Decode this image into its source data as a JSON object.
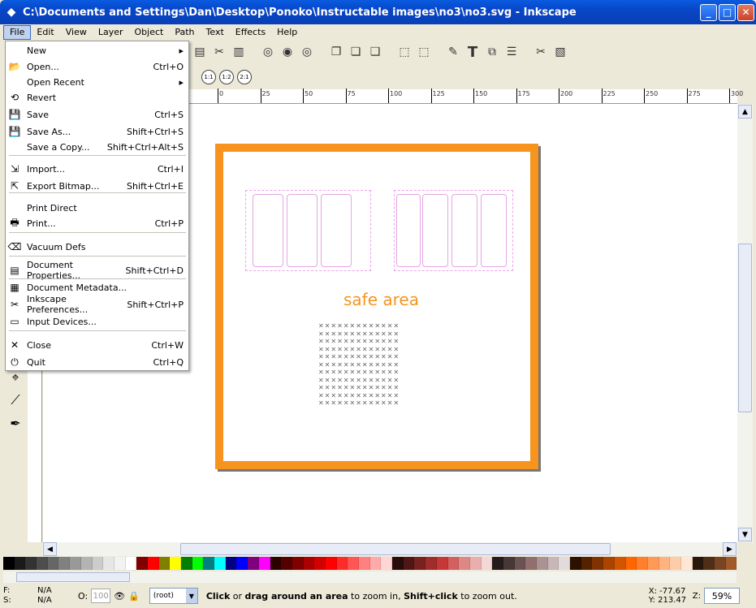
{
  "window": {
    "title": "C:\\Documents and Settings\\Dan\\Desktop\\Ponoko\\Instructable images\\no3\\no3.svg - Inkscape"
  },
  "menubar": [
    "File",
    "Edit",
    "View",
    "Layer",
    "Object",
    "Path",
    "Text",
    "Effects",
    "Help"
  ],
  "file_menu": [
    {
      "label": "New",
      "shortcut": "",
      "icon": "blank",
      "submenu": true
    },
    {
      "label": "Open...",
      "shortcut": "Ctrl+O",
      "icon": "folder-icon"
    },
    {
      "label": "Open Recent",
      "shortcut": "",
      "icon": "blank",
      "submenu": true
    },
    {
      "label": "Revert",
      "shortcut": "",
      "icon": "revert-icon"
    },
    {
      "label": "Save",
      "shortcut": "Ctrl+S",
      "icon": "save-icon"
    },
    {
      "label": "Save As...",
      "shortcut": "Shift+Ctrl+S",
      "icon": "save-as-icon"
    },
    {
      "label": "Save a Copy...",
      "shortcut": "Shift+Ctrl+Alt+S",
      "icon": "blank"
    },
    {
      "label": "Import...",
      "shortcut": "Ctrl+I",
      "icon": "import-icon"
    },
    {
      "label": "Export Bitmap...",
      "shortcut": "Shift+Ctrl+E",
      "icon": "export-icon"
    },
    {
      "label": "Print Direct",
      "shortcut": "",
      "icon": "blank"
    },
    {
      "label": "Print...",
      "shortcut": "Ctrl+P",
      "icon": "printer-icon"
    },
    {
      "label": "Vacuum Defs",
      "shortcut": "",
      "icon": "vacuum-icon"
    },
    {
      "label": "Document Properties...",
      "shortcut": "Shift+Ctrl+D",
      "icon": "doc-props-icon"
    },
    {
      "label": "Document Metadata...",
      "shortcut": "",
      "icon": "doc-meta-icon"
    },
    {
      "label": "Inkscape Preferences...",
      "shortcut": "Shift+Ctrl+P",
      "icon": "prefs-icon"
    },
    {
      "label": "Input Devices...",
      "shortcut": "",
      "icon": "input-icon"
    },
    {
      "label": "Close",
      "shortcut": "Ctrl+W",
      "icon": "close-icon"
    },
    {
      "label": "Quit",
      "shortcut": "Ctrl+Q",
      "icon": "quit-icon"
    }
  ],
  "ruler": {
    "labels": [
      "0",
      "25",
      "50",
      "75",
      "100",
      "125",
      "150",
      "175",
      "200",
      "225",
      "250",
      "275",
      "300"
    ]
  },
  "canvas": {
    "safe_area_text": "safe area",
    "page_border_color": "#f7941d"
  },
  "grid_rows": [
    "✕✕✕✕✕✕✕✕✕✕✕✕✕",
    "✕✕✕✕✕✕✕✕✕✕✕✕✕",
    "✕✕✕✕✕✕✕✕✕✕✕✕✕",
    "✕✕✕✕✕✕✕✕✕✕✕✕✕",
    "✕✕✕✕✕✕✕✕✕✕✕✕✕",
    "✕✕✕✕✕✕✕✕✕✕✕✕✕",
    "✕✕✕✕✕✕✕✕✕✕✕✕✕",
    "✕✕✕✕✕✕✕✕✕✕✕✕✕",
    "✕✕✕✕✕✕✕✕✕✕✕✕✕",
    "✕✕✕✕✕✕✕✕✕✕✕✕✕",
    "✕✕✕✕✕✕✕✕✕✕✕✕✕"
  ],
  "palette": [
    "#000000",
    "#1a1a1a",
    "#333333",
    "#4d4d4d",
    "#666666",
    "#808080",
    "#999999",
    "#b3b3b3",
    "#cccccc",
    "#e6e6e6",
    "#f2f2f2",
    "#ffffff",
    "#800000",
    "#ff0000",
    "#808000",
    "#ffff00",
    "#008000",
    "#00ff00",
    "#008080",
    "#00ffff",
    "#000080",
    "#0000ff",
    "#800080",
    "#ff00ff",
    "#2b0000",
    "#550000",
    "#800000",
    "#aa0000",
    "#d40000",
    "#ff0000",
    "#ff2a2a",
    "#ff5555",
    "#ff8080",
    "#ffaaaa",
    "#ffd5d5",
    "#280b0b",
    "#501616",
    "#782121",
    "#a02c2c",
    "#c83737",
    "#d35f5f",
    "#de8787",
    "#e9afaf",
    "#f4d7d7",
    "#241c1c",
    "#483737",
    "#6c5353",
    "#916f6f",
    "#ac9393",
    "#c8b7b7",
    "#e3dbdb",
    "#2b1100",
    "#552200",
    "#803300",
    "#aa4400",
    "#d45500",
    "#ff6600",
    "#ff7f2a",
    "#ff9955",
    "#ffb380",
    "#ffccaa",
    "#ffe6d5",
    "#28170b",
    "#502d16",
    "#784421",
    "#a05a2c"
  ],
  "status": {
    "fill_label": "F:",
    "stroke_label": "S:",
    "fill_value": "N/A",
    "stroke_value": "N/A",
    "opacity_label": "O:",
    "opacity_value": "100",
    "layer": "(root)",
    "msg_b1": "Click",
    "msg_t1": " or ",
    "msg_b2": "drag around an area",
    "msg_t2": " to zoom in, ",
    "msg_b3": "Shift+click",
    "msg_t3": " to zoom out.",
    "x": "X: -77.67",
    "y": "Y: 213.47",
    "zoom_label": "Z:",
    "zoom": "59%"
  }
}
